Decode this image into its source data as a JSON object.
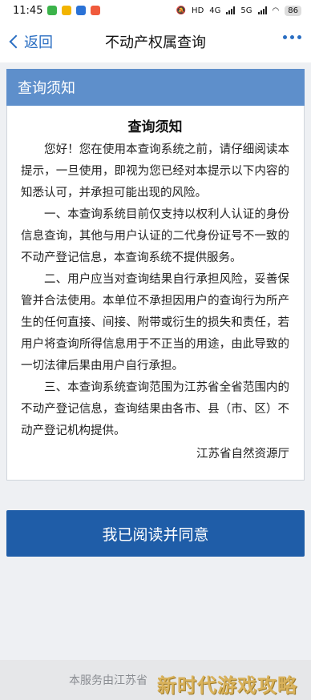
{
  "status_bar": {
    "time": "11:45",
    "network_labels": [
      "HD",
      "4G",
      "5G"
    ],
    "battery": "86",
    "app_icon_colors": [
      "#3bb34a",
      "#f2b400",
      "#2a72d6",
      "#f05a3c"
    ]
  },
  "nav": {
    "back_label": "返回",
    "title": "不动产权属查询"
  },
  "notice": {
    "header": "查询须知",
    "title": "查询须知",
    "paragraphs": [
      "您好！您在使用本查询系统之前，请仔细阅读本提示，一旦使用，即视为您已经对本提示以下内容的知悉认可，并承担可能出现的风险。",
      "一、本查询系统目前仅支持以权利人认证的身份信息查询，其他与用户认证的二代身份证号不一致的不动产登记信息，本查询系统不提供服务。",
      "二、用户应当对查询结果自行承担风险，妥善保管并合法使用。本单位不承担因用户的查询行为所产生的任何直接、间接、附带或衍生的损失和责任，若用户将查询所得信息用于不正当的用途，由此导致的一切法律后果由用户自行承担。",
      "三、本查询系统查询范围为江苏省全省范围内的不动产登记信息，查询结果由各市、县（市、区）不动产登记机构提供。"
    ],
    "signature": "江苏省自然资源厅"
  },
  "agree_button": "我已阅读并同意",
  "footer": {
    "text": "本服务由江苏省",
    "watermark": "新时代游戏攻略"
  },
  "colors": {
    "accent": "#2a6ec2",
    "notice_header_bg": "#5e8fcb",
    "button_bg": "#1f5da8",
    "page_bg": "#eef0f3"
  }
}
